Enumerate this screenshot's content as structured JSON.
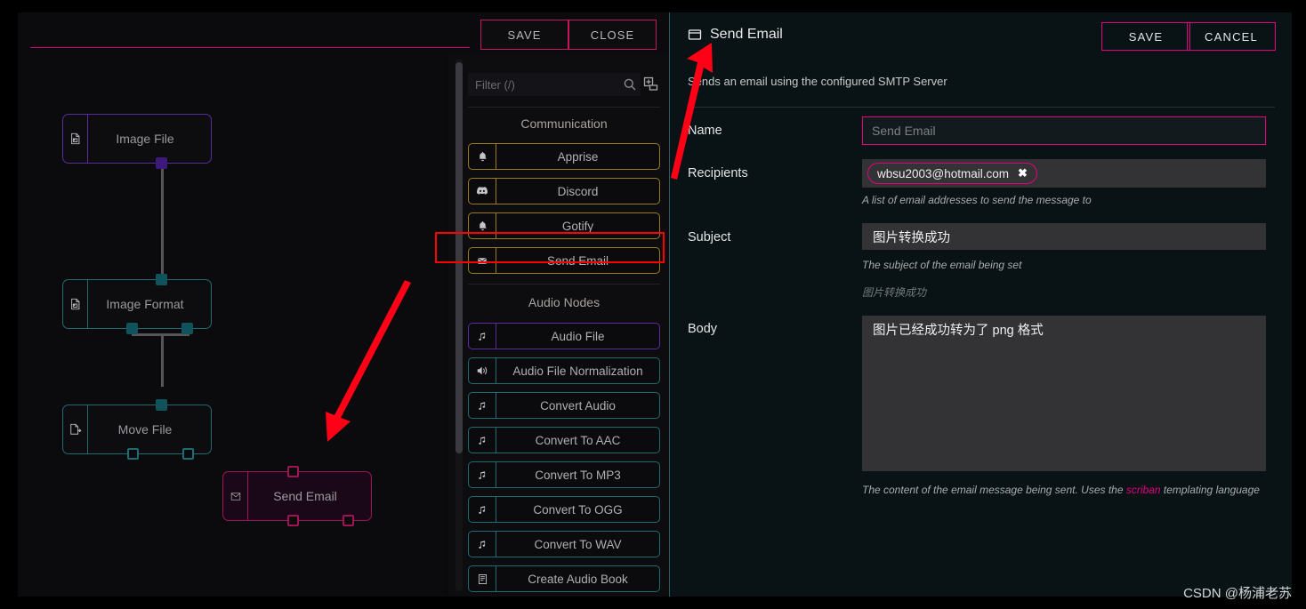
{
  "editor": {
    "name_value": "",
    "name_placeholder": "",
    "save_label": "SAVE",
    "close_label": "CLOSE"
  },
  "canvas": {
    "nodes": [
      {
        "label": "Image File",
        "icon": "image-file-icon",
        "color": "#5b2a9e"
      },
      {
        "label": "Image Format",
        "icon": "image-file-icon",
        "color": "#1f6a73"
      },
      {
        "label": "Move File",
        "icon": "move-file-icon",
        "color": "#1f6a73"
      },
      {
        "label": "Send Email",
        "icon": "envelope-icon",
        "color": "#a01456"
      }
    ]
  },
  "palette": {
    "filter_placeholder": "Filter (/)",
    "filter_value": "",
    "search_icon": "search-icon",
    "collapse_icon": "collapse-all-icon",
    "groups": [
      {
        "title": "Communication",
        "style": "gold",
        "items": [
          {
            "label": "Apprise",
            "icon": "bell-icon"
          },
          {
            "label": "Discord",
            "icon": "discord-icon"
          },
          {
            "label": "Gotify",
            "icon": "bell-icon"
          },
          {
            "label": "Send Email",
            "icon": "envelope-icon"
          }
        ]
      },
      {
        "title": "Audio Nodes",
        "items": [
          {
            "label": "Audio File",
            "icon": "music-note-icon",
            "style": "purple"
          },
          {
            "label": "Audio File Normalization",
            "icon": "speaker-icon",
            "style": "teal"
          },
          {
            "label": "Convert Audio",
            "icon": "music-note-icon",
            "style": "teal"
          },
          {
            "label": "Convert To AAC",
            "icon": "music-note-icon",
            "style": "teal"
          },
          {
            "label": "Convert To MP3",
            "icon": "music-note-icon",
            "style": "teal"
          },
          {
            "label": "Convert To OGG",
            "icon": "music-note-icon",
            "style": "teal"
          },
          {
            "label": "Convert To WAV",
            "icon": "music-note-icon",
            "style": "teal"
          },
          {
            "label": "Create Audio Book",
            "icon": "book-icon",
            "style": "teal"
          }
        ]
      }
    ]
  },
  "properties": {
    "title": "Send Email",
    "title_icon": "window-panel-icon",
    "save_label": "SAVE",
    "cancel_label": "CANCEL",
    "description": "Sends an email using the configured SMTP Server",
    "fields": {
      "name": {
        "label": "Name",
        "value": "",
        "placeholder": "Send Email"
      },
      "recipients": {
        "label": "Recipients",
        "chip": "wbsu2003@hotmail.com",
        "chip_remove": "✖",
        "help": "A list of email addresses to send the message to"
      },
      "subject": {
        "label": "Subject",
        "value": "图片转换成功",
        "help": "The subject of the email being set",
        "help2": "图片转换成功"
      },
      "body": {
        "label": "Body",
        "value": "图片已经成功转为了 png 格式",
        "help_before": "The content of the email message being sent. Uses the ",
        "help_link": "scriban",
        "help_after": " templating language"
      }
    }
  },
  "annotations": {
    "highlight_color": "#ff0000",
    "arrow_color": "#ff0016",
    "watermark": "CSDN @杨浦老苏"
  }
}
